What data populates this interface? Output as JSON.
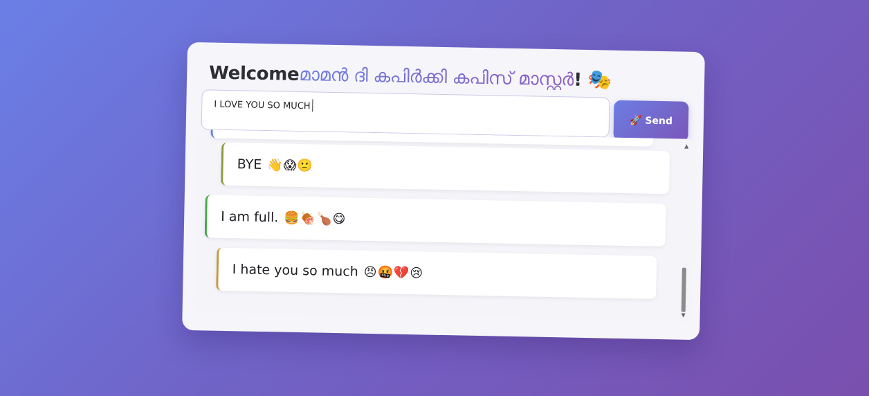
{
  "header": {
    "title_prefix": "Welcome",
    "title_malayalam": "മാമൻ ദി കപിർക്കി കപിസ് മാസ്റ്റർ",
    "title_suffix": "!",
    "title_icon": "🎭"
  },
  "composer": {
    "input_value": "I LOVE YOU SO MUCH",
    "send_icon": "🚀",
    "send_label": "Send"
  },
  "messages": [
    {
      "text": "BYE",
      "emojis": "👋😱🙁"
    },
    {
      "text": "I am full.",
      "emojis": "🍔🍖🍗😋"
    },
    {
      "text": "I hate you so much",
      "emojis": "😠🤬💔😢"
    }
  ],
  "colors": {
    "accent": "#6a7fe6",
    "accent_end": "#7b56b8",
    "msg_border_1": "#8a9a3a",
    "msg_border_2": "#46a84a",
    "msg_border_3": "#c49a3a"
  }
}
